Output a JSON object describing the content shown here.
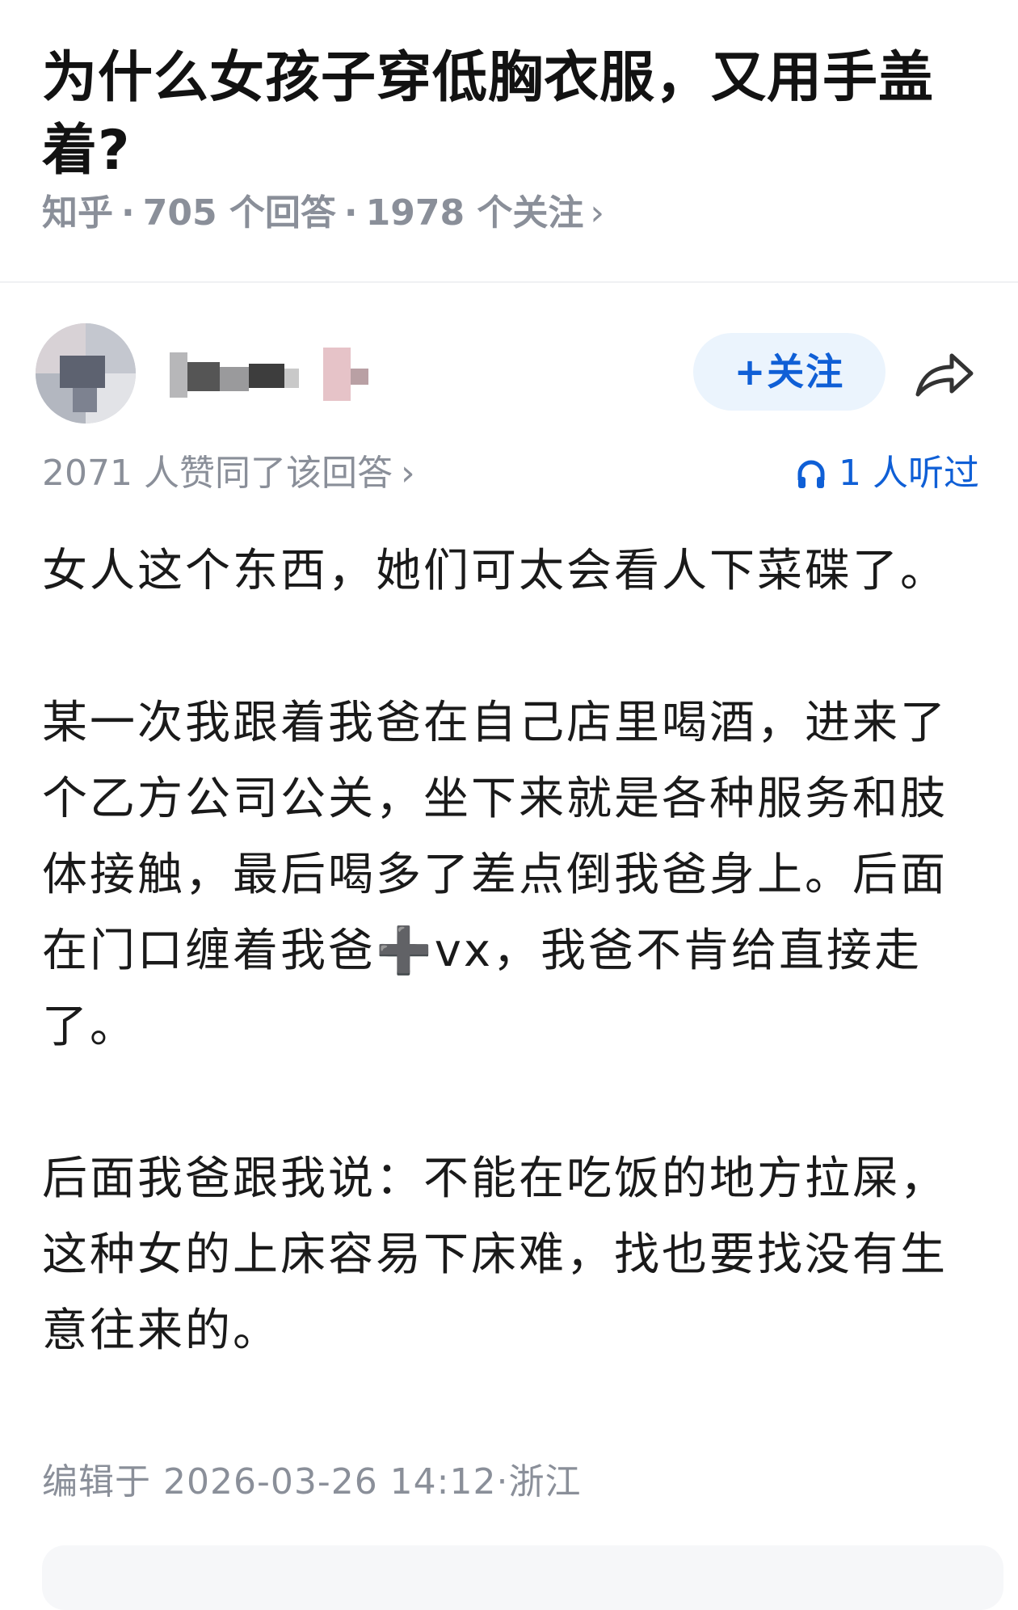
{
  "question": {
    "title": "为什么女孩子穿低胸衣服，又用手盖着?",
    "source": "知乎",
    "answers_count": "705 个回答",
    "followers_count": "1978 个关注",
    "chevron": "›"
  },
  "author": {
    "follow_label": "+关注",
    "avatar_icon": "blurred-avatar",
    "share_icon": "share-arrow-icon"
  },
  "answer": {
    "votes_text": "2071 人赞同了该回答",
    "chevron": "›",
    "listen_text": "1 人听过",
    "paragraphs": [
      "女人这个东西，她们可太会看人下菜碟了。",
      "某一次我跟着我爸在自己店里喝酒，进来了个乙方公司公关，坐下来就是各种服务和肢体接触，最后喝多了差点倒我爸身上。后面在门口缠着我爸➕vx，我爸不肯给直接走了。",
      "后面我爸跟我说：不能在吃饭的地方拉屎，这种女的上床容易下床难，找也要找没有生意往来的。"
    ],
    "edit_info": "编辑于 2026-03-26 14:12·浙江"
  },
  "colors": {
    "accent": "#0f5fd6",
    "muted": "#8a8f99",
    "follow_bg": "#ebf4fd"
  }
}
